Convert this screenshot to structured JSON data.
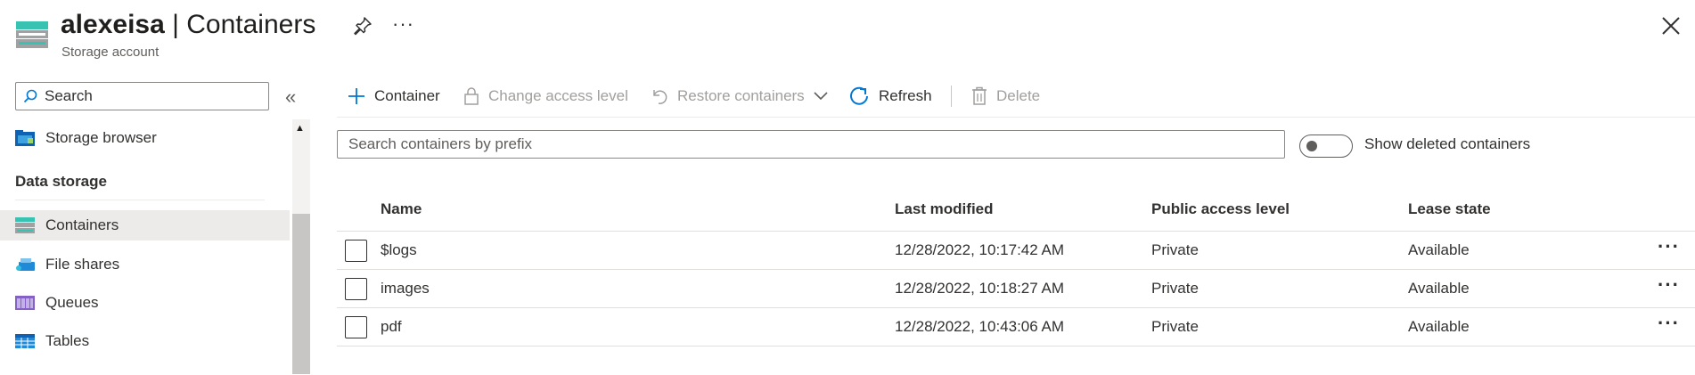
{
  "header": {
    "account": "alexeisa",
    "separator": " | ",
    "page": "Containers",
    "subtitle": "Storage account",
    "more_glyph": "···"
  },
  "sidebar": {
    "search_placeholder": "Search",
    "collapse_glyph": "«",
    "items_top": [
      {
        "label": "Storage browser",
        "icon": "storage-browser-icon"
      }
    ],
    "section_label": "Data storage",
    "items": [
      {
        "label": "Containers",
        "icon": "containers-icon",
        "selected": true
      },
      {
        "label": "File shares",
        "icon": "file-shares-icon"
      },
      {
        "label": "Queues",
        "icon": "queues-icon"
      },
      {
        "label": "Tables",
        "icon": "tables-icon"
      }
    ]
  },
  "toolbar": {
    "container": "Container",
    "change_access": "Change access level",
    "restore": "Restore containers",
    "refresh": "Refresh",
    "delete": "Delete"
  },
  "filter": {
    "search_placeholder": "Search containers by prefix",
    "show_deleted_label": "Show deleted containers",
    "show_deleted": false
  },
  "table": {
    "columns": [
      "Name",
      "Last modified",
      "Public access level",
      "Lease state"
    ],
    "rows": [
      {
        "name": "$logs",
        "last_modified": "12/28/2022, 10:17:42 AM",
        "access": "Private",
        "lease": "Available",
        "more": "···"
      },
      {
        "name": "images",
        "last_modified": "12/28/2022, 10:18:27 AM",
        "access": "Private",
        "lease": "Available",
        "more": "···"
      },
      {
        "name": "pdf",
        "last_modified": "12/28/2022, 10:43:06 AM",
        "access": "Private",
        "lease": "Available",
        "more": "···"
      }
    ]
  },
  "colors": {
    "accent": "#0078d4",
    "selected_bg": "#edebe9",
    "disabled_text": "#a19f9d"
  }
}
